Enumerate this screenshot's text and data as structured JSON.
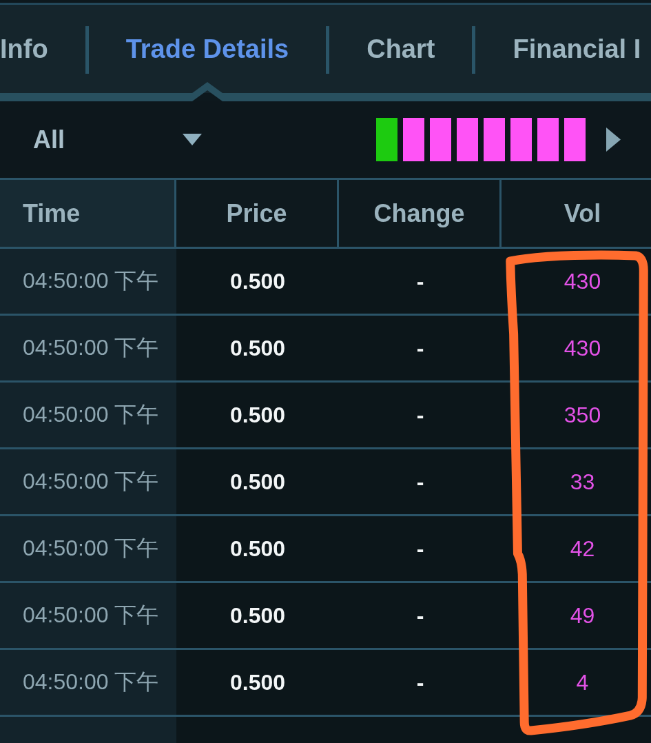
{
  "tabs": [
    {
      "label": "Info",
      "selected": false
    },
    {
      "label": "Trade Details",
      "selected": true
    },
    {
      "label": "Chart",
      "selected": false
    },
    {
      "label": "Financial I",
      "selected": false
    }
  ],
  "filter": {
    "value": "All",
    "blocks": [
      {
        "color": "#1dcb10"
      },
      {
        "color": "#ff53f6"
      },
      {
        "color": "#ff53f6"
      },
      {
        "color": "#ff53f6"
      },
      {
        "color": "#ff53f6"
      },
      {
        "color": "#ff53f6"
      },
      {
        "color": "#ff53f6"
      },
      {
        "color": "#ff53f6"
      }
    ]
  },
  "table": {
    "columns": [
      {
        "label": "Time",
        "circled": false
      },
      {
        "label": "Price",
        "circled": false
      },
      {
        "label": "Change",
        "circled": false
      },
      {
        "label": "Vol",
        "circled": true
      }
    ],
    "rows": [
      {
        "time": "04:50:00 下午",
        "price": "0.500",
        "change": "-",
        "vol": "430"
      },
      {
        "time": "04:50:00 下午",
        "price": "0.500",
        "change": "-",
        "vol": "430"
      },
      {
        "time": "04:50:00 下午",
        "price": "0.500",
        "change": "-",
        "vol": "350"
      },
      {
        "time": "04:50:00 下午",
        "price": "0.500",
        "change": "-",
        "vol": "33"
      },
      {
        "time": "04:50:00 下午",
        "price": "0.500",
        "change": "-",
        "vol": "42"
      },
      {
        "time": "04:50:00 下午",
        "price": "0.500",
        "change": "-",
        "vol": "49"
      },
      {
        "time": "04:50:00 下午",
        "price": "0.500",
        "change": "-",
        "vol": "4"
      }
    ]
  }
}
